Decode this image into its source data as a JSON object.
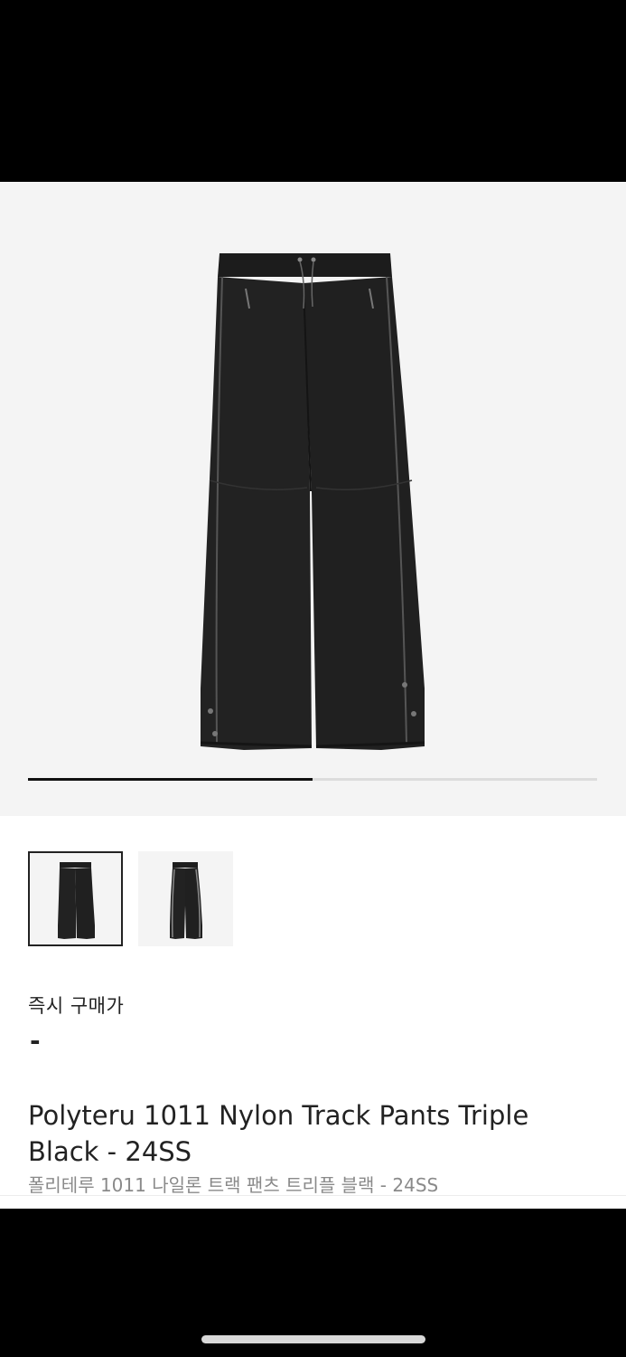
{
  "gallery": {
    "image_name": "pants-front-image",
    "progress": 0.5,
    "thumbnails": [
      {
        "name": "front",
        "selected": true
      },
      {
        "name": "side",
        "selected": false
      }
    ]
  },
  "product": {
    "buy_now_label": "즉시 구매가",
    "price": "-",
    "title_en": "Polyteru 1011 Nylon Track Pants Triple Black - 24SS",
    "title_ko": "폴리테루 1011 나일론 트랙 팬츠 트리플 블랙 - 24SS"
  },
  "colors": {
    "accent": "#111111",
    "muted_text": "#8a8a8a",
    "hero_bg": "#f4f4f4"
  }
}
